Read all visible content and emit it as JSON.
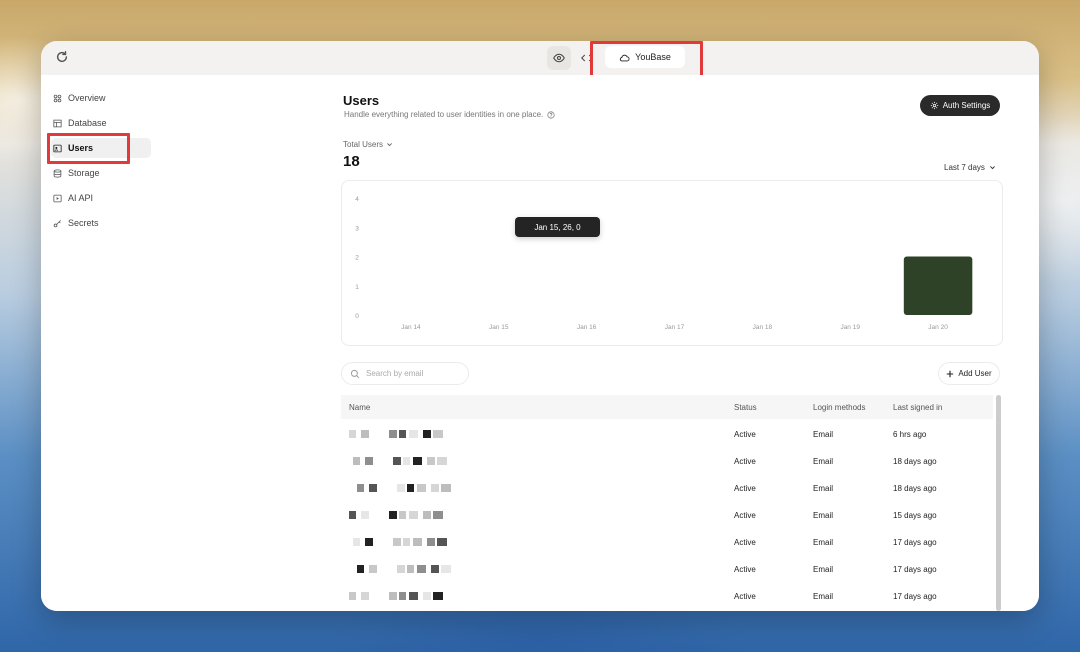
{
  "titlebar": {
    "tab_label": "YouBase",
    "icons": [
      "reload-icon",
      "eye-icon",
      "code-icon",
      "cloud-icon"
    ]
  },
  "sidebar": {
    "items": [
      {
        "label": "Overview",
        "icon": "overview-icon"
      },
      {
        "label": "Database",
        "icon": "table-icon"
      },
      {
        "label": "Users",
        "icon": "users-icon",
        "active": true
      },
      {
        "label": "Storage",
        "icon": "storage-icon"
      },
      {
        "label": "AI API",
        "icon": "play-icon"
      },
      {
        "label": "Secrets",
        "icon": "key-icon"
      }
    ]
  },
  "header": {
    "title": "Users",
    "subtitle": "Handle everything related to user identities in one place.",
    "auth_settings_label": "Auth Settings"
  },
  "stats": {
    "total_label": "Total Users",
    "total_value": "18",
    "range_label": "Last 7 days"
  },
  "chart_data": {
    "type": "bar",
    "categories": [
      "Jan 14",
      "Jan 15",
      "Jan 16",
      "Jan 17",
      "Jan 18",
      "Jan 19",
      "Jan 20"
    ],
    "values": [
      0,
      0,
      0,
      0,
      0,
      0,
      2
    ],
    "yticks": [
      "0",
      "1",
      "2",
      "3",
      "4"
    ],
    "ylim": [
      0,
      4
    ],
    "bar_color": "#2e4227",
    "tooltip": "Jan 15, 26, 0"
  },
  "table": {
    "search_placeholder": "Search by email",
    "add_user_label": "Add User",
    "columns": [
      "Name",
      "Status",
      "Login methods",
      "Last signed in"
    ],
    "rows": [
      {
        "status": "Active",
        "login": "Email",
        "last": "6 hrs ago"
      },
      {
        "status": "Active",
        "login": "Email",
        "last": "18 days ago"
      },
      {
        "status": "Active",
        "login": "Email",
        "last": "18 days ago"
      },
      {
        "status": "Active",
        "login": "Email",
        "last": "15 days ago"
      },
      {
        "status": "Active",
        "login": "Email",
        "last": "17 days ago"
      },
      {
        "status": "Active",
        "login": "Email",
        "last": "17 days ago"
      },
      {
        "status": "Active",
        "login": "Email",
        "last": "17 days ago"
      }
    ]
  },
  "colors": {
    "highlight": "#e03a3a",
    "accent_dark": "#2a2a2a"
  }
}
